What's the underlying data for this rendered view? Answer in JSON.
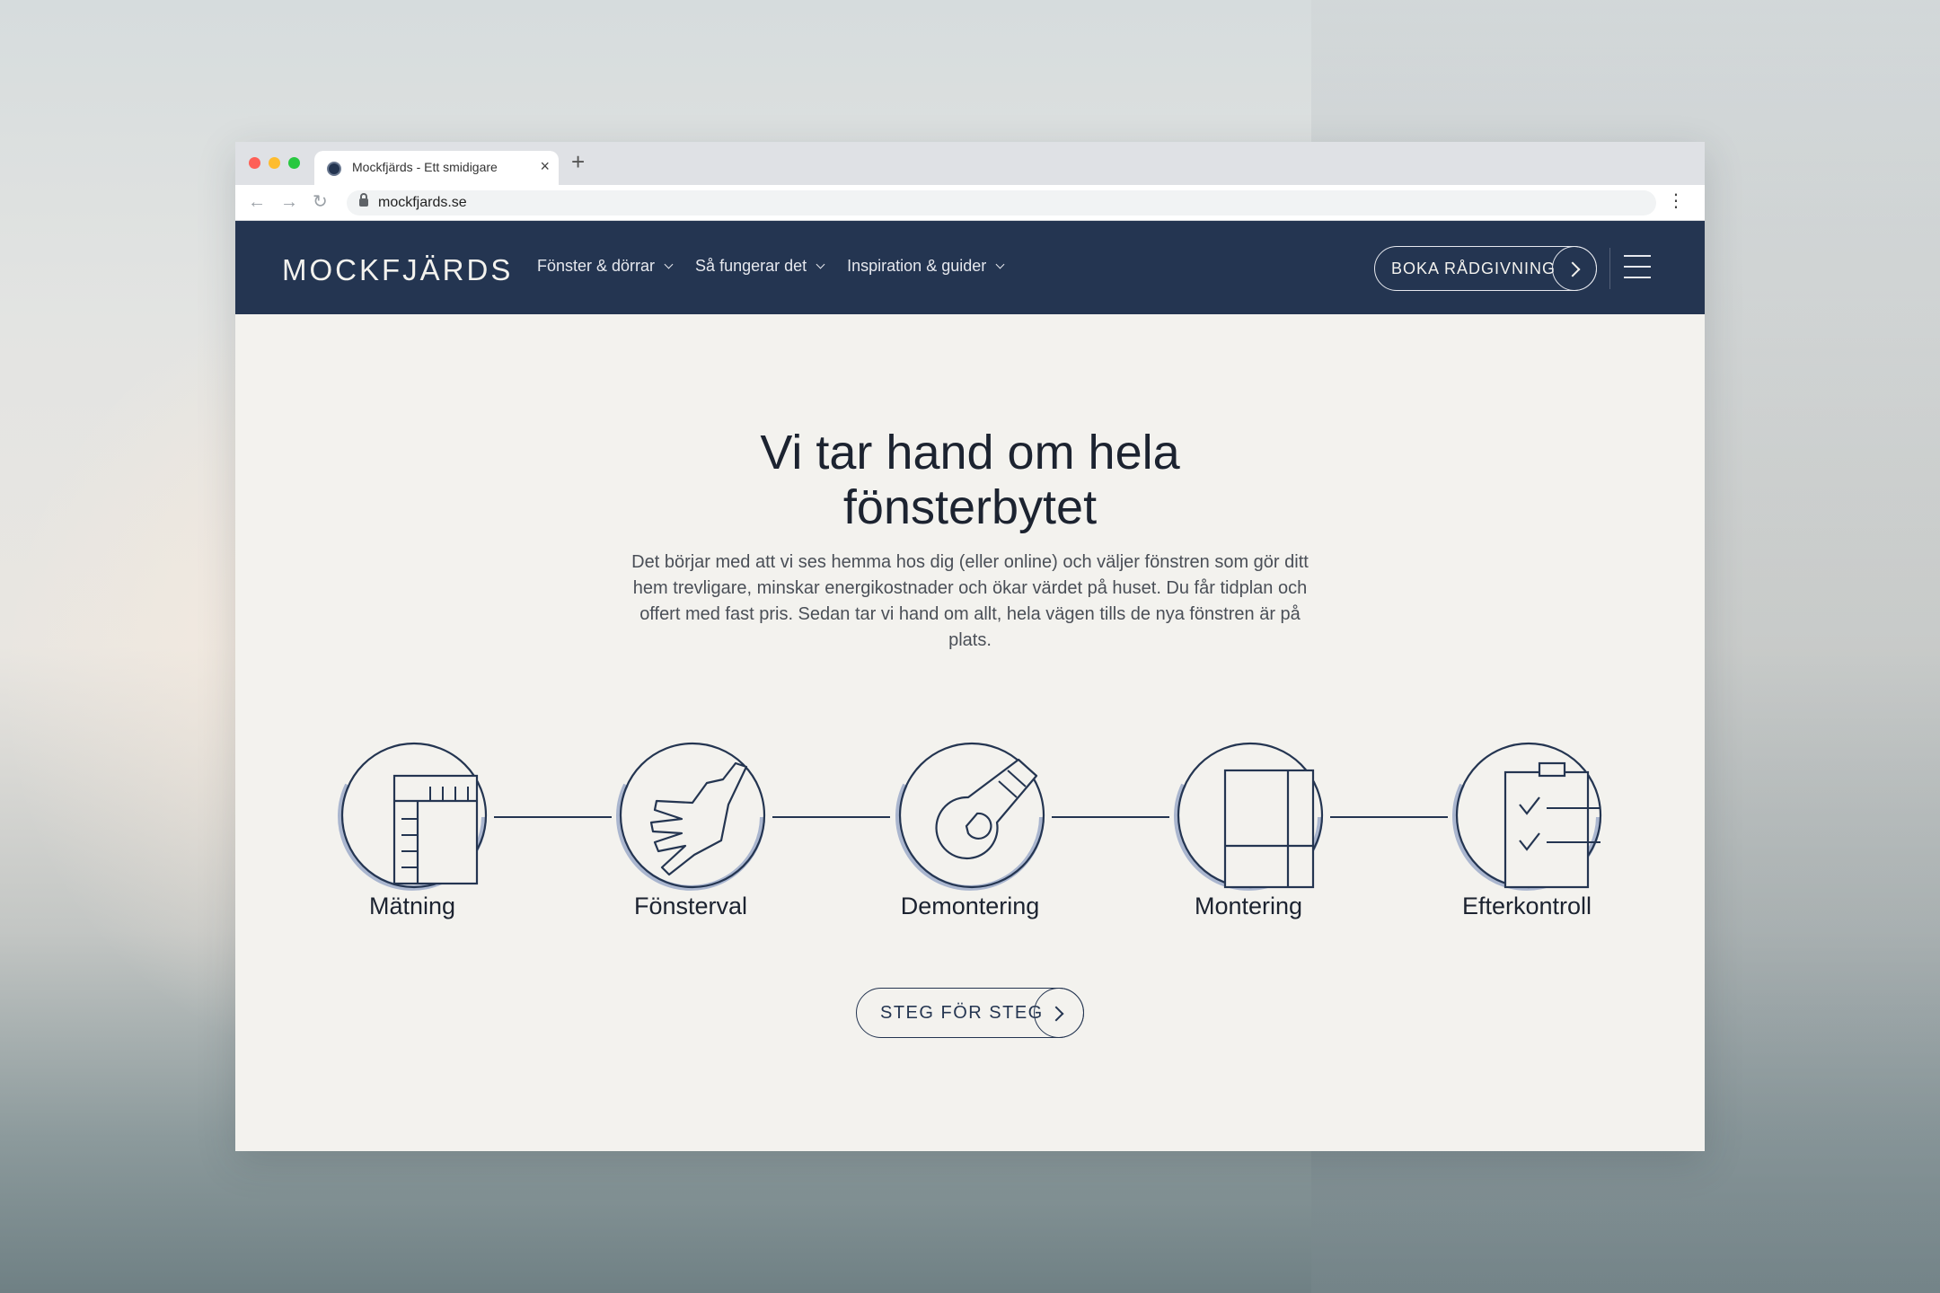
{
  "browser": {
    "tab_title": "Mockfjärds - Ett smidigare",
    "url": "mockfjards.se"
  },
  "header": {
    "logo": "MOCKFJÄRDS",
    "menu": [
      {
        "label": "Fönster & dörrar"
      },
      {
        "label": "Så fungerar det"
      },
      {
        "label": "Inspiration & guider"
      }
    ],
    "cta_label": "BOKA RÅDGIVNING"
  },
  "hero": {
    "title_line1": "Vi tar hand om hela",
    "title_line2": "fönsterbytet",
    "text": "Det börjar med att vi ses hemma hos dig (eller online) och väljer fönstren som gör ditt hem trevligare, minskar energikostnader och ökar värdet på huset. Du får tidplan och offert med fast pris. Sedan tar vi hand om allt, hela vägen tills de nya fönstren är på plats."
  },
  "steps": [
    {
      "label": "Mätning",
      "icon": "measuring-ruler-icon"
    },
    {
      "label": "Fönsterval",
      "icon": "hand-pointing-icon"
    },
    {
      "label": "Demontering",
      "icon": "wrench-icon"
    },
    {
      "label": "Montering",
      "icon": "window-frame-icon"
    },
    {
      "label": "Efterkontroll",
      "icon": "checklist-icon"
    }
  ],
  "cta": {
    "label": "STEG FÖR STEG"
  },
  "colors": {
    "brand_navy": "#243551",
    "page_background": "#f3f2ee",
    "icon_accent": "#aab6cf"
  }
}
